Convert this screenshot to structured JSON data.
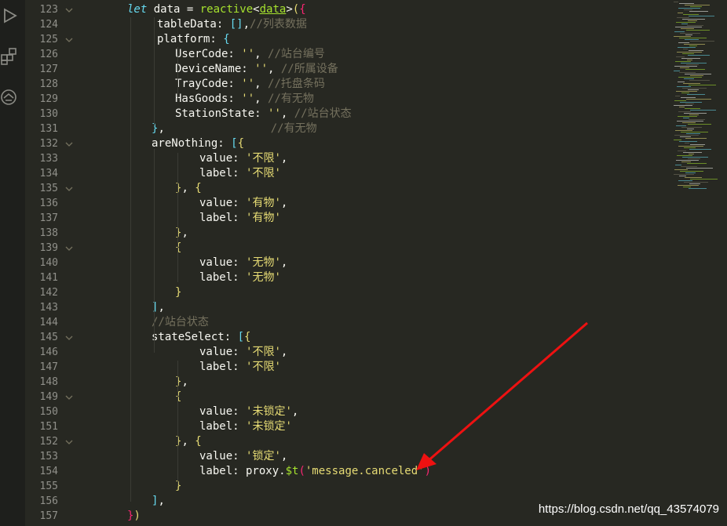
{
  "activity_bar": {
    "icons": [
      "run-debug-icon",
      "extensions-icon",
      "remote-icon"
    ]
  },
  "editor": {
    "lines": [
      {
        "n": "123",
        "fold": true,
        "indent": 62,
        "tokens": [
          [
            "kw",
            "let"
          ],
          [
            "prop",
            " data "
          ],
          [
            "punct",
            "= "
          ],
          [
            "fn",
            "reactive"
          ],
          [
            "punct",
            "<"
          ],
          [
            "ty",
            "data"
          ],
          [
            "punct",
            ">"
          ],
          [
            "br-y",
            "("
          ],
          [
            "br-p",
            "{"
          ]
        ]
      },
      {
        "n": "124",
        "fold": false,
        "indent": 100,
        "tokens": [
          [
            "prop",
            "tableData: "
          ],
          [
            "br-b",
            "[]"
          ],
          [
            "punct",
            ","
          ],
          [
            "cm",
            "//列表数据"
          ]
        ]
      },
      {
        "n": "125",
        "fold": true,
        "indent": 100,
        "tokens": [
          [
            "prop",
            "platform: "
          ],
          [
            "br-b",
            "{"
          ]
        ]
      },
      {
        "n": "126",
        "fold": false,
        "indent": 123,
        "tokens": [
          [
            "prop",
            "UserCode: "
          ],
          [
            "str",
            "''"
          ],
          [
            "punct",
            ", "
          ],
          [
            "cm",
            "//站台编号"
          ]
        ]
      },
      {
        "n": "127",
        "fold": false,
        "indent": 123,
        "tokens": [
          [
            "prop",
            "DeviceName: "
          ],
          [
            "str",
            "''"
          ],
          [
            "punct",
            ", "
          ],
          [
            "cm",
            "//所属设备"
          ]
        ]
      },
      {
        "n": "128",
        "fold": false,
        "indent": 123,
        "tokens": [
          [
            "prop",
            "TrayCode: "
          ],
          [
            "str",
            "''"
          ],
          [
            "punct",
            ", "
          ],
          [
            "cm",
            "//托盘条码"
          ]
        ]
      },
      {
        "n": "129",
        "fold": false,
        "indent": 123,
        "tokens": [
          [
            "prop",
            "HasGoods: "
          ],
          [
            "str",
            "''"
          ],
          [
            "punct",
            ", "
          ],
          [
            "cm",
            "//有无物"
          ]
        ]
      },
      {
        "n": "130",
        "fold": false,
        "indent": 123,
        "tokens": [
          [
            "prop",
            "StationState: "
          ],
          [
            "str",
            "''"
          ],
          [
            "punct",
            ", "
          ],
          [
            "cm",
            "//站台状态"
          ]
        ]
      },
      {
        "n": "131",
        "fold": false,
        "indent": 93,
        "tokens": [
          [
            "br-b",
            "}"
          ],
          [
            "punct",
            ","
          ],
          [
            "cm",
            "                //有无物"
          ]
        ]
      },
      {
        "n": "132",
        "fold": true,
        "indent": 93,
        "tokens": [
          [
            "prop",
            "areNothing: "
          ],
          [
            "br-b",
            "["
          ],
          [
            "br-y",
            "{"
          ]
        ]
      },
      {
        "n": "133",
        "fold": false,
        "indent": 154,
        "tokens": [
          [
            "prop",
            "value: "
          ],
          [
            "str",
            "'不限'"
          ],
          [
            "punct",
            ","
          ]
        ]
      },
      {
        "n": "134",
        "fold": false,
        "indent": 154,
        "tokens": [
          [
            "prop",
            "label: "
          ],
          [
            "str",
            "'不限'"
          ]
        ]
      },
      {
        "n": "135",
        "fold": true,
        "indent": 123,
        "tokens": [
          [
            "br-y",
            "}"
          ],
          [
            "punct",
            ", "
          ],
          [
            "br-y",
            "{"
          ]
        ]
      },
      {
        "n": "136",
        "fold": false,
        "indent": 154,
        "tokens": [
          [
            "prop",
            "value: "
          ],
          [
            "str",
            "'有物'"
          ],
          [
            "punct",
            ","
          ]
        ]
      },
      {
        "n": "137",
        "fold": false,
        "indent": 154,
        "tokens": [
          [
            "prop",
            "label: "
          ],
          [
            "str",
            "'有物'"
          ]
        ]
      },
      {
        "n": "138",
        "fold": false,
        "indent": 123,
        "tokens": [
          [
            "br-y",
            "}"
          ],
          [
            "punct",
            ","
          ]
        ]
      },
      {
        "n": "139",
        "fold": true,
        "indent": 123,
        "tokens": [
          [
            "br-y",
            "{"
          ]
        ]
      },
      {
        "n": "140",
        "fold": false,
        "indent": 154,
        "tokens": [
          [
            "prop",
            "value: "
          ],
          [
            "str",
            "'无物'"
          ],
          [
            "punct",
            ","
          ]
        ]
      },
      {
        "n": "141",
        "fold": false,
        "indent": 154,
        "tokens": [
          [
            "prop",
            "label: "
          ],
          [
            "str",
            "'无物'"
          ]
        ]
      },
      {
        "n": "142",
        "fold": false,
        "indent": 123,
        "tokens": [
          [
            "br-y",
            "}"
          ]
        ]
      },
      {
        "n": "143",
        "fold": false,
        "indent": 93,
        "tokens": [
          [
            "br-b",
            "]"
          ],
          [
            "punct",
            ","
          ]
        ]
      },
      {
        "n": "144",
        "fold": false,
        "indent": 93,
        "tokens": [
          [
            "cm",
            "//站台状态"
          ]
        ]
      },
      {
        "n": "145",
        "fold": true,
        "indent": 93,
        "tokens": [
          [
            "prop",
            "stateSelect: "
          ],
          [
            "br-b",
            "["
          ],
          [
            "br-y",
            "{"
          ]
        ]
      },
      {
        "n": "146",
        "fold": false,
        "indent": 154,
        "tokens": [
          [
            "prop",
            "value: "
          ],
          [
            "str",
            "'不限'"
          ],
          [
            "punct",
            ","
          ]
        ]
      },
      {
        "n": "147",
        "fold": false,
        "indent": 154,
        "tokens": [
          [
            "prop",
            "label: "
          ],
          [
            "str",
            "'不限'"
          ]
        ]
      },
      {
        "n": "148",
        "fold": false,
        "indent": 123,
        "tokens": [
          [
            "br-y",
            "}"
          ],
          [
            "punct",
            ","
          ]
        ]
      },
      {
        "n": "149",
        "fold": true,
        "indent": 123,
        "tokens": [
          [
            "br-y",
            "{"
          ]
        ]
      },
      {
        "n": "150",
        "fold": false,
        "indent": 154,
        "tokens": [
          [
            "prop",
            "value: "
          ],
          [
            "str",
            "'未锁定'"
          ],
          [
            "punct",
            ","
          ]
        ]
      },
      {
        "n": "151",
        "fold": false,
        "indent": 154,
        "tokens": [
          [
            "prop",
            "label: "
          ],
          [
            "str",
            "'未锁定'"
          ]
        ]
      },
      {
        "n": "152",
        "fold": true,
        "indent": 123,
        "tokens": [
          [
            "br-y",
            "}"
          ],
          [
            "punct",
            ", "
          ],
          [
            "br-y",
            "{"
          ]
        ]
      },
      {
        "n": "153",
        "fold": false,
        "indent": 154,
        "tokens": [
          [
            "prop",
            "value: "
          ],
          [
            "str",
            "'锁定'"
          ],
          [
            "punct",
            ","
          ]
        ]
      },
      {
        "n": "154",
        "fold": false,
        "indent": 154,
        "tokens": [
          [
            "prop",
            "label: proxy."
          ],
          [
            "fn",
            "$t"
          ],
          [
            "br-p",
            "("
          ],
          [
            "str",
            "'message.canceled'"
          ],
          [
            "br-p",
            ")"
          ]
        ]
      },
      {
        "n": "155",
        "fold": false,
        "indent": 123,
        "tokens": [
          [
            "br-y",
            "}"
          ]
        ]
      },
      {
        "n": "156",
        "fold": false,
        "indent": 93,
        "tokens": [
          [
            "br-b",
            "]"
          ],
          [
            "punct",
            ","
          ]
        ]
      },
      {
        "n": "157",
        "fold": false,
        "indent": 62,
        "tokens": [
          [
            "br-p",
            "}"
          ],
          [
            "br-y",
            ")"
          ]
        ]
      }
    ]
  },
  "watermark": "https://blog.csdn.net/qq_43574079",
  "colors": {
    "background": "#272822",
    "arrow": "#ee1111"
  }
}
